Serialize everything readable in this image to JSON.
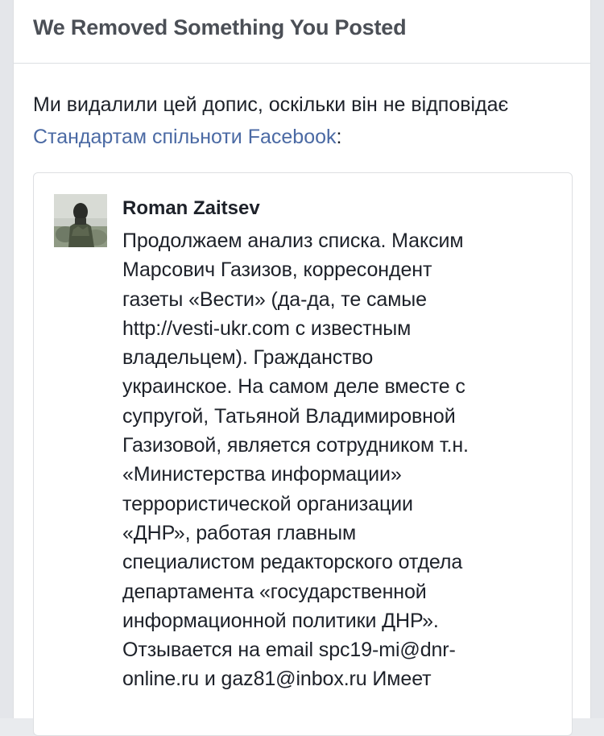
{
  "header": {
    "title": "We Removed Something You Posted"
  },
  "notice": {
    "text_before_link": "Ми видалили цей допис, оскільки він не відповідає ",
    "link_text": "Стандартам спільноти Facebook",
    "text_after_link": ":"
  },
  "post": {
    "author": "Roman Zaitsev",
    "avatar_icon": "user-photo-icon",
    "body_lines": [
      "Продолжаем анализ списка. Максим",
      "Марсович Газизов, корресондент",
      "газеты «Вести» (да-да, те самые",
      "http://vesti-ukr.com с известным",
      "владельцем). Гражданство",
      "украинское. На самом деле вместе с",
      "супругой, Татьяной Владимировной",
      "Газизовой, является сотрудником т.н.",
      "«Министерства информации»",
      "террористической организации",
      "«ДНР», работая главным",
      "специалистом редакторского отдела",
      "департамента «государственной",
      "информационной политики ДНР».",
      "Отзывается на email spc19-mi@dnr-",
      "online.ru и gaz81@inbox.ru Имеет"
    ]
  },
  "colors": {
    "link": "#4b6aa4",
    "title": "#4b4f56",
    "text": "#1d2129",
    "border": "#dddfe2",
    "page_bg": "#e9ebee"
  }
}
